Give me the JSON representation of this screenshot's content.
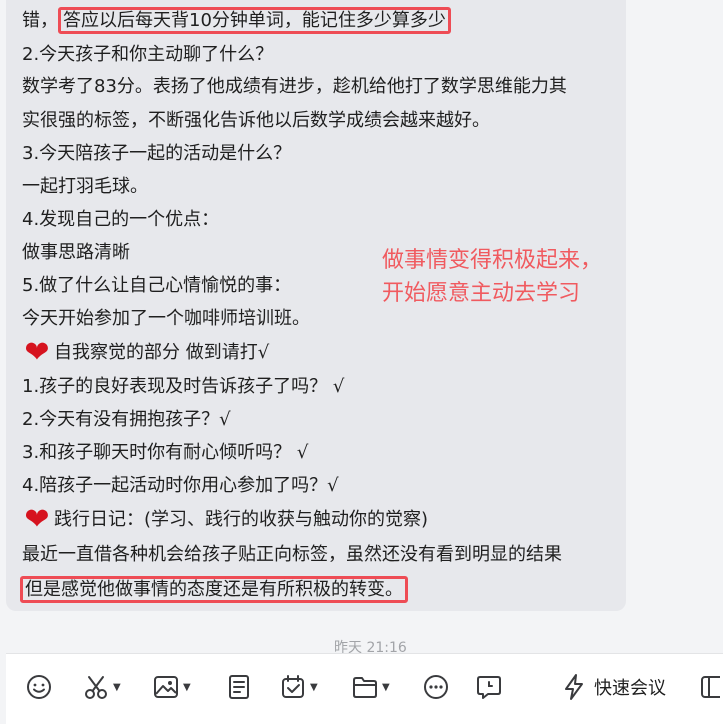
{
  "message": {
    "line1_prefix": "错，",
    "line1_highlight": "答应以后每天背10分钟单词，能记住多少算多少",
    "line2": "2.今天孩子和你主动聊了什么？",
    "line3": "数学考了83分。表扬了他成绩有进步，趁机给他打了数学思维能力其",
    "line4": "实很强的标签，不断强化告诉他以后数学成绩会越来越好。",
    "line5": "3.今天陪孩子一起的活动是什么？",
    "line6": "一起打羽毛球。",
    "line7": "4.发现自己的一个优点：",
    "line8": "做事思路清晰",
    "line9": "5.做了什么让自己心情愉悦的事：",
    "line10": "今天开始参加了一个咖啡师培训班。",
    "line11": "自我察觉的部分 做到请打√",
    "line12": "1.孩子的良好表现及时告诉孩子了吗？ √",
    "line13": "2.今天有没有拥抱孩子？√",
    "line14": "3.和孩子聊天时你有耐心倾听吗？ √",
    "line15": "4.陪孩子一起活动时你用心参加了吗？√",
    "line16": "践行日记：(学习、践行的收获与触动你的觉察)",
    "line17": "最近一直借各种机会给孩子贴正向标签，虽然还没有看到明显的结果",
    "line18_highlight": "但是感觉他做事情的态度还是有所积极的转变。"
  },
  "annotation": {
    "line1": "做事情变得积极起来，",
    "line2": "开始愿意主动去学习"
  },
  "timestamp": "昨天 21:16",
  "toolbar": {
    "icons": [
      "emoji-icon",
      "scissors-icon",
      "image-icon",
      "document-icon",
      "calendar-check-icon",
      "folder-icon",
      "more-icon",
      "chat-icon",
      "lightning-icon"
    ],
    "meeting_label": "快速会议"
  },
  "colors": {
    "highlight": "#ee4c55",
    "annotation": "#f05a5f",
    "bubble": "#e7e8ec",
    "heart": "#d6131f"
  }
}
